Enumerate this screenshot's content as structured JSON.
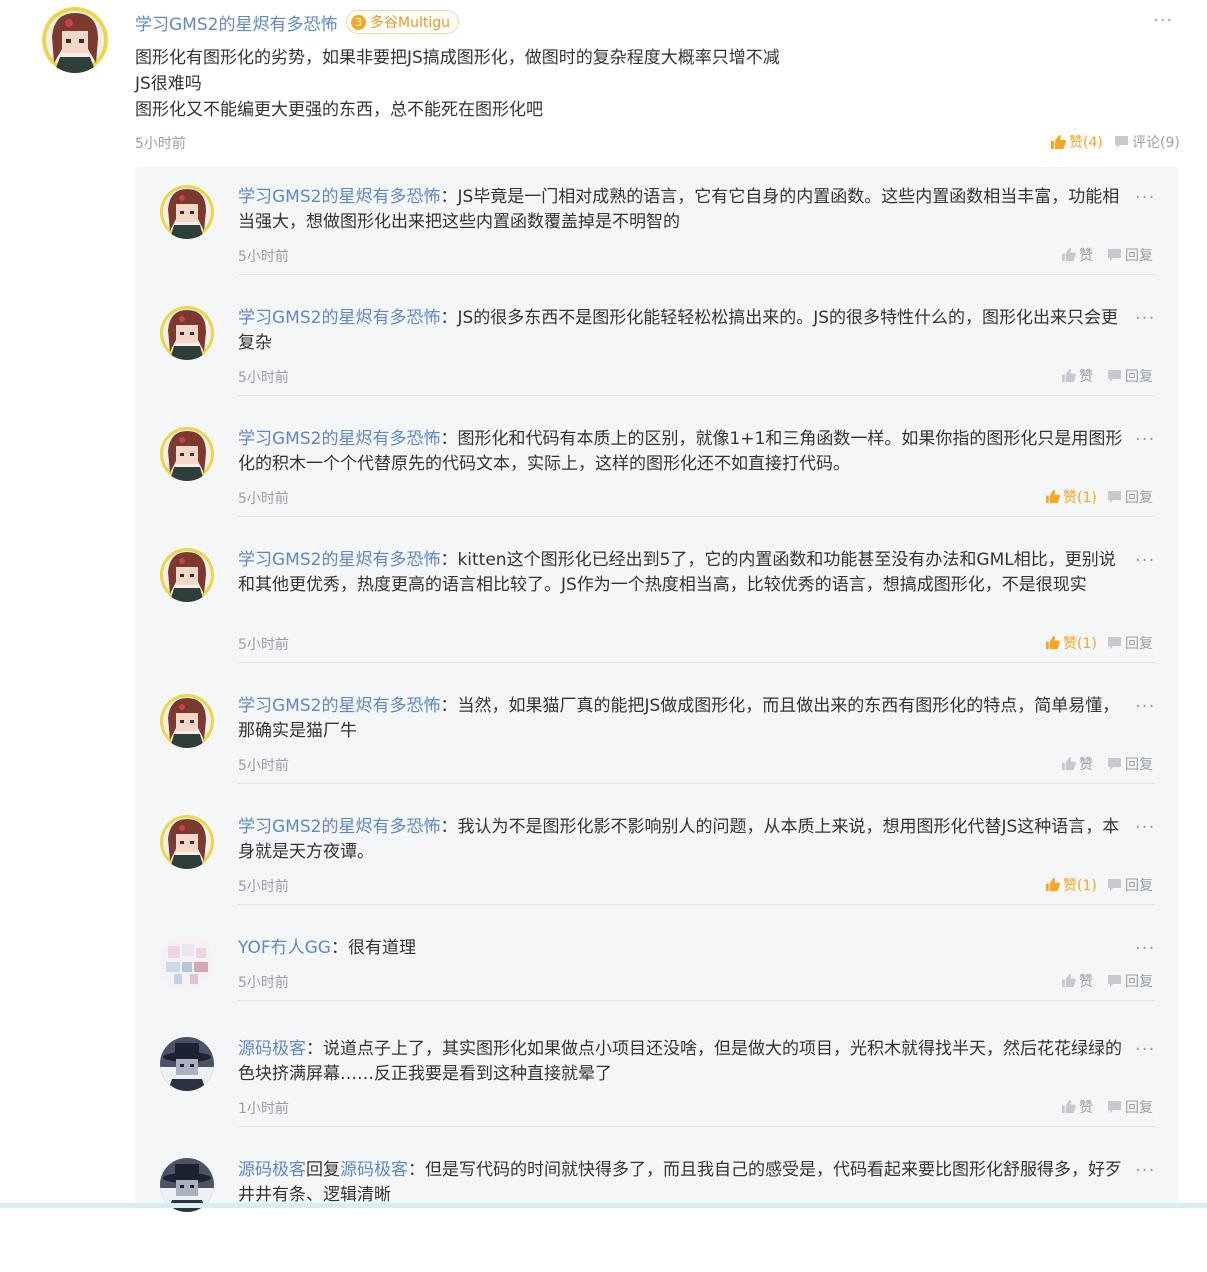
{
  "post": {
    "username": "学习GMS2的星烬有多恐怖",
    "badge_level": "3",
    "badge_text": "多谷Multigu",
    "lines": [
      "图形化有图形化的劣势，如果非要把JS搞成图形化，做图时的复杂程度大概率只增不减",
      "JS很难吗",
      "图形化又不能编更大更强的东西，总不能死在图形化吧"
    ],
    "time": "5小时前",
    "like_label": "赞(4)",
    "comment_label": "评论(9)",
    "more": "···"
  },
  "replies": [
    {
      "username": "学习GMS2的星烬有多恐怖",
      "text": "JS毕竟是一门相对成熟的语言，它有它自身的内置函数。这些内置函数相当丰富，功能相当强大，想做图形化出来把这些内置函数覆盖掉是不明智的",
      "time": "5小时前",
      "like_label": "赞",
      "liked": false,
      "reply_label": "回复",
      "avatar": "girl"
    },
    {
      "username": "学习GMS2的星烬有多恐怖",
      "text": "JS的很多东西不是图形化能轻轻松松搞出来的。JS的很多特性什么的，图形化出来只会更复杂",
      "time": "5小时前",
      "like_label": "赞",
      "liked": false,
      "reply_label": "回复",
      "avatar": "girl"
    },
    {
      "username": "学习GMS2的星烬有多恐怖",
      "text": "图形化和代码有本质上的区别，就像1+1和三角函数一样。如果你指的图形化只是用图形化的积木一个个代替原先的代码文本，实际上，这样的图形化还不如直接打代码。",
      "time": "5小时前",
      "like_label": "赞(1)",
      "liked": true,
      "reply_label": "回复",
      "avatar": "girl"
    },
    {
      "username": "学习GMS2的星烬有多恐怖",
      "text": "kitten这个图形化已经出到5了，它的内置函数和功能甚至没有办法和GML相比，更别说和其他更优秀，热度更高的语言相比较了。JS作为一个热度相当高，比较优秀的语言，想搞成图形化，不是很现实",
      "time": "5小时前",
      "like_label": "赞(1)",
      "liked": true,
      "reply_label": "回复",
      "avatar": "girl"
    },
    {
      "username": "学习GMS2的星烬有多恐怖",
      "text": "当然，如果猫厂真的能把JS做成图形化，而且做出来的东西有图形化的特点，简单易懂，那确实是猫厂牛",
      "time": "5小时前",
      "like_label": "赞",
      "liked": false,
      "reply_label": "回复",
      "avatar": "girl"
    },
    {
      "username": "学习GMS2的星烬有多恐怖",
      "text": "我认为不是图形化影不影响别人的问题，从本质上来说，想用图形化代替JS这种语言，本身就是天方夜谭。",
      "time": "5小时前",
      "like_label": "赞(1)",
      "liked": true,
      "reply_label": "回复",
      "avatar": "girl"
    },
    {
      "username": "YOF冇人GG",
      "text": "很有道理",
      "time": "5小时前",
      "like_label": "赞",
      "liked": false,
      "reply_label": "回复",
      "avatar": "pixel"
    },
    {
      "username": "源码极客",
      "text": "说道点子上了，其实图形化如果做点小项目还没啥，但是做大的项目，光积木就得找半天，然后花花绿绿的色块挤满屏幕……反正我要是看到这种直接就晕了",
      "time": "1小时前",
      "like_label": "赞",
      "liked": false,
      "reply_label": "回复",
      "avatar": "hat"
    },
    {
      "username": "源码极客",
      "reply_word": "回复",
      "reply_to": "源码极客",
      "text": "但是写代码的时间就快得多了，而且我自己的感受是，代码看起来要比图形化舒服得多，好歹井井有条、逻辑清晰",
      "time": "",
      "like_label": "",
      "liked": false,
      "reply_label": "",
      "avatar": "hat"
    }
  ],
  "colors": {
    "link": "#5e88c8",
    "accent": "#f5a623",
    "muted": "#9aa0a6",
    "panel": "#f5f6f7"
  }
}
